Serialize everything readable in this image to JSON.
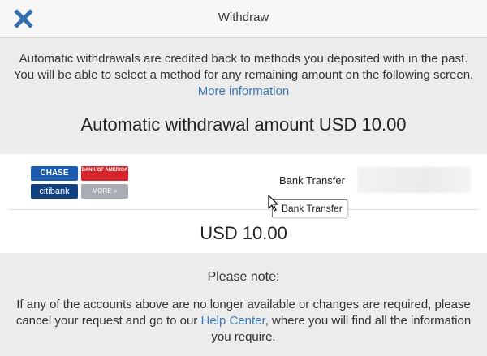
{
  "header": {
    "title": "Withdraw",
    "close_icon": "close-icon"
  },
  "info": {
    "text": "Automatic withdrawals are credited back to methods you deposited with in the past. You will be able to select a method for any remaining amount on the following screen.",
    "link": "More information"
  },
  "amount_title": "Automatic withdrawal amount USD 10.00",
  "method": {
    "logos": {
      "chase": "CHASE",
      "boa": "BANK OF AMERICA",
      "citi": "citibank",
      "more": "MORE »"
    },
    "label": "Bank Transfer",
    "tooltip": "Bank Transfer",
    "amount": "USD 10.00"
  },
  "note": {
    "title": "Please note:",
    "text_before": "If any of the accounts above are no longer available or changes are required, please cancel your request and go to our",
    "link": "Help Center",
    "text_after": ", where you will find all the information you require."
  },
  "colors": {
    "accent": "#2f6fb0",
    "link": "#3a78b7",
    "background": "#ececec",
    "panel": "#ffffff"
  }
}
